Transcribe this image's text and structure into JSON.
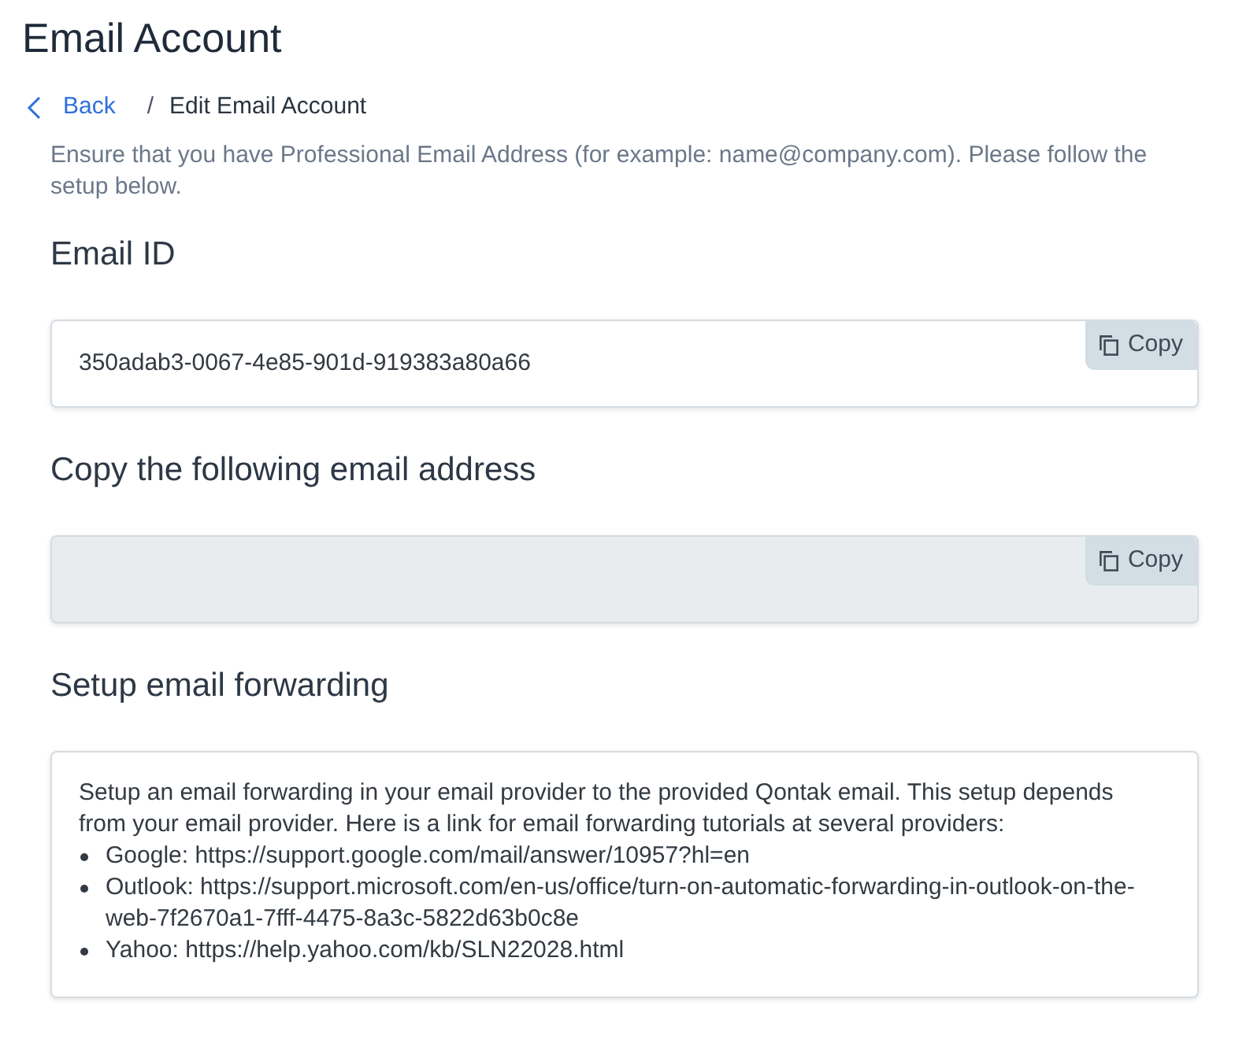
{
  "page": {
    "title": "Email Account"
  },
  "breadcrumb": {
    "back": "Back",
    "separator": "/",
    "current": "Edit Email Account"
  },
  "description": "Ensure that you have Professional Email Address (for example: name@company.com). Please follow the setup below.",
  "sections": [
    {
      "kind": "field",
      "heading": "Email ID",
      "value": "350adab3-0067-4e85-901d-919383a80a66",
      "disabled": false,
      "copy_button": "Copy"
    },
    {
      "kind": "field",
      "heading": "Copy the following email address",
      "disabled": true,
      "copy_button": "Copy"
    },
    {
      "kind": "text",
      "heading": "Setup email forwarding",
      "text": "Setup an email forwarding in your email provider to the provided Qontak email. This setup depends from your email provider. Here is a link for email forwarding tutorials at several providers:",
      "items": [
        "Google: https://support.google.com/mail/answer/10957?hl=en",
        "Outlook: https://support.microsoft.com/en-us/office/turn-on-automatic-forwarding-in-outlook-on-the-web-7f2670a1-7fff-4475-8a3c-5822d63b0c8e",
        "Yahoo: https://help.yahoo.com/kb/SLN22028.html"
      ]
    }
  ]
}
